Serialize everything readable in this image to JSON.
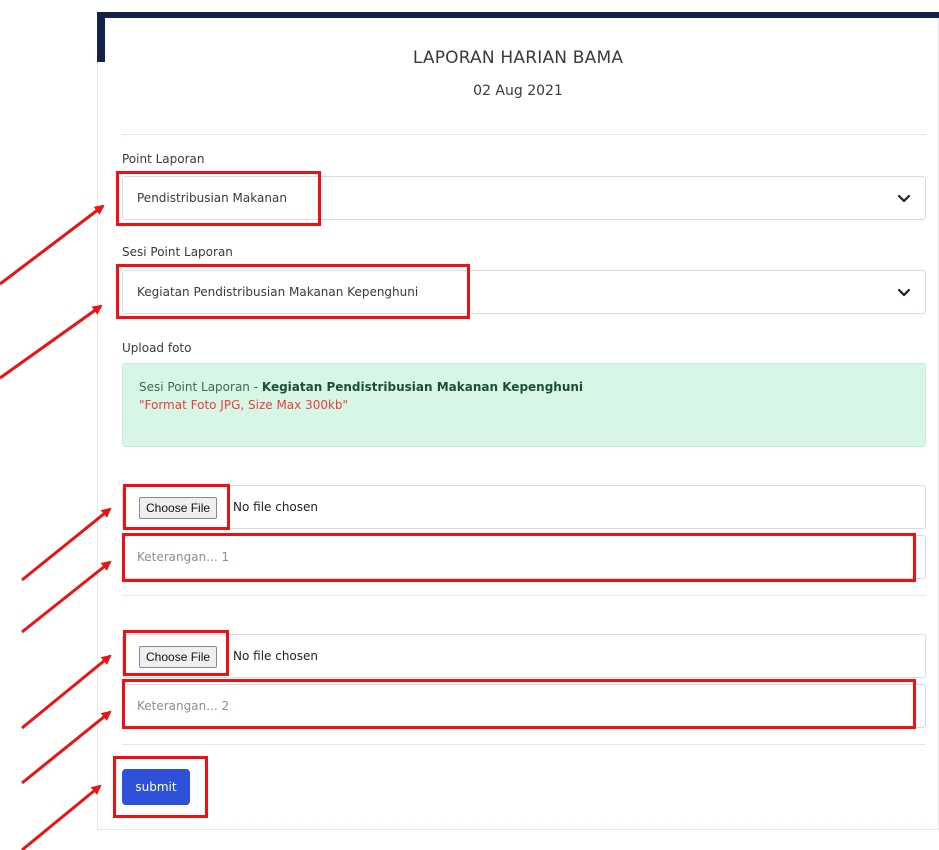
{
  "form": {
    "title": "LAPORAN HARIAN BAMA",
    "date": "02 Aug 2021",
    "point_label": "Point Laporan",
    "point_value": "Pendistribusian Makanan",
    "sesi_label": "Sesi Point Laporan",
    "sesi_value": "Kegiatan Pendistribusian Makanan Kepenghuni",
    "upload_label": "Upload foto",
    "alert": {
      "prefix": "Sesi Point Laporan - ",
      "bold": "Kegiatan Pendistribusian Makanan Kepenghuni",
      "note": "\"Format Foto JPG, Size Max 300kb\""
    },
    "uploads": [
      {
        "button": "Choose File",
        "status": "No file chosen",
        "placeholder": "Keterangan... 1"
      },
      {
        "button": "Choose File",
        "status": "No file chosen",
        "placeholder": "Keterangan... 2"
      }
    ],
    "submit_label": "submit"
  },
  "colors": {
    "header_bar": "#13224a",
    "alert_bg": "#d8f6e6",
    "alert_note": "#e83f3f",
    "submit_bg": "#2f50d8",
    "annotation": "#ee1111"
  },
  "icons": {
    "select_chevron": "chevron-down-icon"
  }
}
